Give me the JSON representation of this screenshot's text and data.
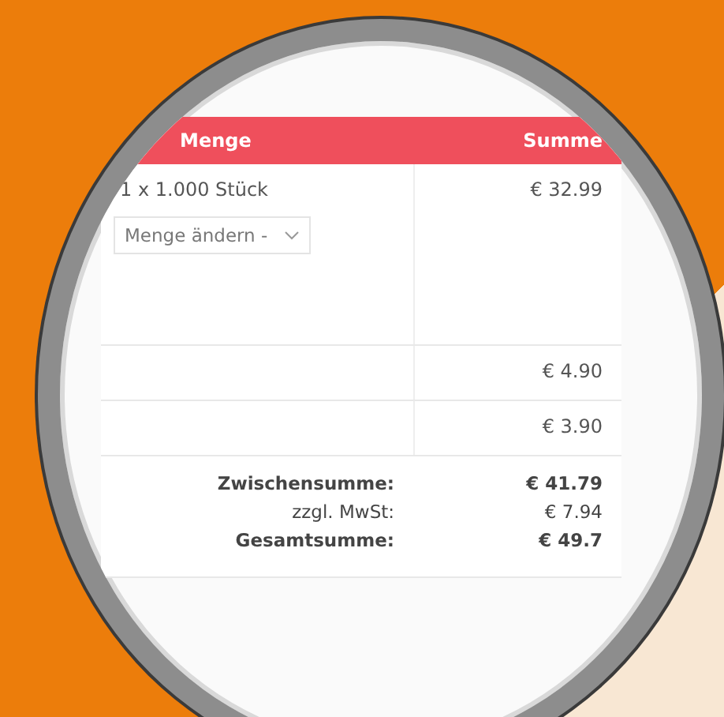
{
  "table": {
    "columns": [
      "Menge",
      "Summe"
    ],
    "rows": [
      {
        "kind": "item",
        "quantity": "1 x 1.000 Stück",
        "select": "Menge ändern -",
        "sum": "€ 32.99"
      },
      {
        "kind": "charge",
        "sum": "€ 4.90"
      },
      {
        "kind": "charge",
        "sum": "€ 3.90"
      }
    ],
    "totals": [
      {
        "label": "Zwischensumme:",
        "value": "€ 41.79",
        "emphasized": true
      },
      {
        "label": "zzgl. MwSt:",
        "value": "€ 7.94",
        "emphasized": false
      },
      {
        "label": "Gesamtsumme:",
        "value": "€ 49.7",
        "emphasized": true
      }
    ]
  }
}
